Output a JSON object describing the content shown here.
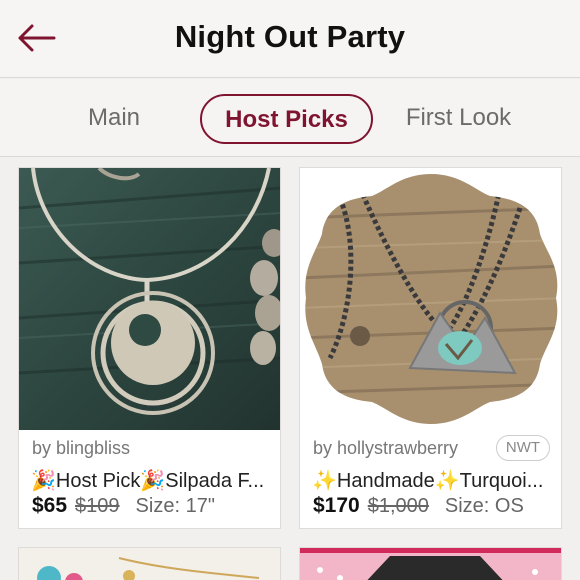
{
  "header": {
    "title": "Night Out Party"
  },
  "tabs": [
    {
      "label": "Main"
    },
    {
      "label": "Host Picks"
    },
    {
      "label": "First Look"
    }
  ],
  "listings": [
    {
      "seller": "by blingbliss",
      "title": "🎉Host Pick🎉Silpada F...",
      "price": "$65",
      "original_price": "$109",
      "size": "Size: 17\""
    },
    {
      "seller": "by hollystrawberry",
      "badge": "NWT",
      "title": "✨Handmade✨Turquoi...",
      "price": "$170",
      "original_price": "$1,000",
      "size": "Size: OS"
    }
  ],
  "colors": {
    "accent": "#7f1431",
    "background": "#f2f0ef"
  },
  "icons": {
    "back": "arrow-left-icon"
  }
}
